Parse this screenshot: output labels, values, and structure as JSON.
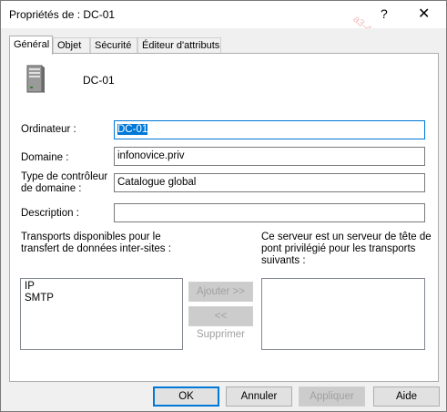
{
  "window": {
    "title": "Propriétés de : DC-01",
    "help_glyph": "?",
    "close_glyph": "✕"
  },
  "watermark": "a3-4f5c-b1a7-6c2e-8a03c-b6d3bd70f06 test",
  "tabs": [
    {
      "label": "Général",
      "active": true
    },
    {
      "label": "Objet",
      "active": false
    },
    {
      "label": "Sécurité",
      "active": false
    },
    {
      "label": "Éditeur d'attributs",
      "active": false
    }
  ],
  "header": {
    "server_name": "DC-01"
  },
  "fields": {
    "computer": {
      "label": "Ordinateur :",
      "value": "DC-01"
    },
    "domain": {
      "label": "Domaine :",
      "value": "infonovice.priv"
    },
    "dc_type": {
      "label_line1": "Type de contrôleur",
      "label_line2": "de domaine :",
      "value": "Catalogue global"
    },
    "description": {
      "label": "Description :",
      "value": ""
    }
  },
  "transports": {
    "available_label_line1": "Transports disponibles pour le",
    "available_label_line2": "transfert de données inter-sites :",
    "bridgehead_label_line1": "Ce serveur est un serveur de tête de",
    "bridgehead_label_line2": "pont privilégié pour les transports",
    "bridgehead_label_line3": "suivants :",
    "available_items": [
      "IP",
      "SMTP"
    ],
    "add_button": "Ajouter >>",
    "remove_button": "<< Supprimer"
  },
  "footer": {
    "ok": "OK",
    "cancel": "Annuler",
    "apply": "Appliquer",
    "help": "Aide"
  }
}
